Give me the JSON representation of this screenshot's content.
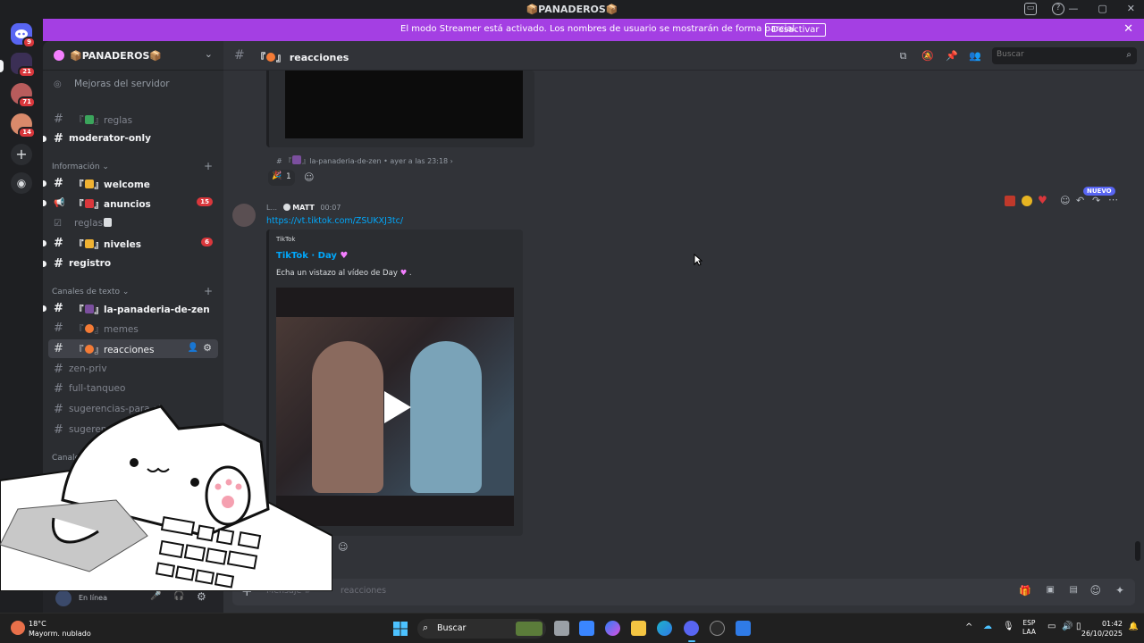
{
  "window": {
    "title": "📦PANADEROS📦"
  },
  "rail": {
    "servers": [
      {
        "badge": "9",
        "color": "#5865f2"
      },
      {
        "badge": "21",
        "color": "#3b2f55"
      },
      {
        "badge": "71",
        "color": "#b85c5c"
      },
      {
        "badge": "14",
        "color": "#d98a6b"
      }
    ]
  },
  "banner": {
    "message": "El modo Streamer está activado. Los nombres de usuario se mostrarán de forma parcial.",
    "button": "Desactivar",
    "close": "✕"
  },
  "sidebar": {
    "server_name": "📦PANADEROS📦",
    "boosts": "Mejoras del servidor",
    "channels_top": [
      {
        "label": "reglas",
        "unread": false
      },
      {
        "label": "moderator-only",
        "unread": true
      }
    ],
    "category_info": "Información",
    "channels_info": [
      {
        "label": "welcome",
        "unread": true
      },
      {
        "label": "anuncios",
        "unread": true,
        "badge": "15"
      },
      {
        "label": "reglas",
        "unread": false
      },
      {
        "label": "niveles",
        "unread": true,
        "badge": "6"
      },
      {
        "label": "registro",
        "unread": true
      }
    ],
    "category_text": "Canales de texto",
    "channels_text": [
      {
        "label": "la-panaderia-de-zen",
        "unread": true
      },
      {
        "label": "memes",
        "unread": false
      },
      {
        "label": "reacciones",
        "unread": false,
        "active": true
      },
      {
        "label": "zen-priv",
        "unread": false
      },
      {
        "label": "full-tanqueo",
        "unread": false
      },
      {
        "label": "sugerencias-para-st",
        "unread": false
      },
      {
        "label": "sugerencias",
        "unread": false
      }
    ],
    "category_voice": "Canales d",
    "status": "En línea"
  },
  "chat": {
    "channel_name": "reacciones",
    "search_placeholder": "Buscar",
    "prev_message": {
      "forwarded_from": "la-panaderia-de-zen",
      "time": "ayer a las 23:18",
      "reaction_count": "1"
    },
    "message": {
      "author_prefix": "L...",
      "author_tag": "MATT",
      "time": "00:07",
      "link": "https://vt.tiktok.com/ZSUKXJ3tc/",
      "new_badge": "NUEVO",
      "embed": {
        "provider": "TikTok",
        "title": "TikTok · Day",
        "description": "Echa un vistazo al vídeo de Day"
      }
    },
    "composer_placeholder": "Mensaje #",
    "composer_channel": "reacciones"
  },
  "taskbar": {
    "temp": "18°C",
    "weather": "Mayorm. nublado",
    "search": "Buscar",
    "lang_top": "ESP",
    "lang_bottom": "LAA",
    "time": "01:42",
    "date": "26/10/2025"
  },
  "colors": {
    "accent": "#a43fe3",
    "link": "#00a8fc",
    "badge": "#da373c"
  }
}
